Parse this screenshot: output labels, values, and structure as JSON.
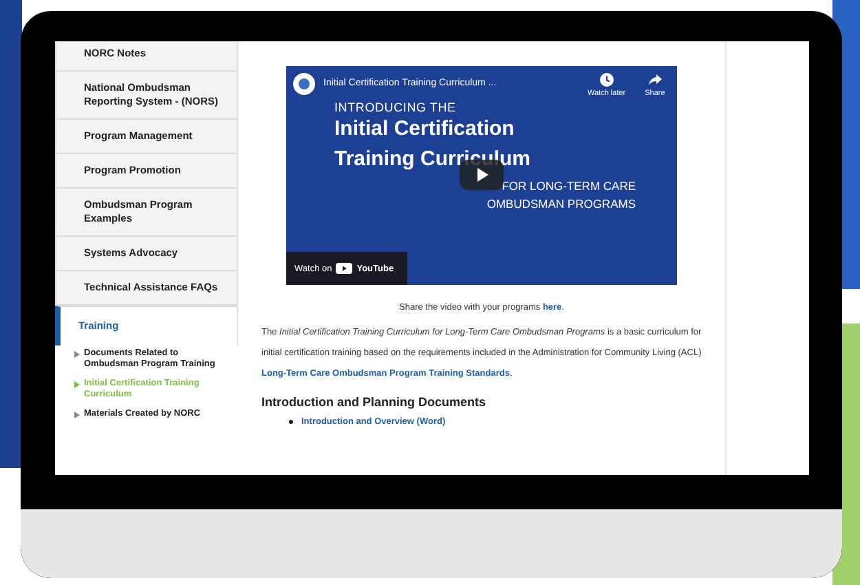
{
  "sidebar": {
    "items": [
      {
        "label": "NORC Notes",
        "selected": false
      },
      {
        "label": "National Ombudsman Reporting System - (NORS)",
        "selected": false
      },
      {
        "label": "Program Management",
        "selected": false
      },
      {
        "label": "Program Promotion",
        "selected": false
      },
      {
        "label": "Ombudsman Program Examples",
        "selected": false
      },
      {
        "label": "Systems Advocacy",
        "selected": false
      },
      {
        "label": "Technical Assistance FAQs",
        "selected": false
      },
      {
        "label": "Training",
        "selected": true,
        "children": [
          {
            "label": "Documents Related to Ombudsman Program Training",
            "selected": false
          },
          {
            "label": "Initial Certification Training Curriculum",
            "selected": true
          },
          {
            "label": "Materials Created by NORC",
            "selected": false
          }
        ]
      }
    ]
  },
  "video": {
    "title": "Initial Certification Training Curriculum ...",
    "watch_later": "Watch later",
    "share": "Share",
    "kicker": "INTRODUCING THE",
    "headline": [
      "Initial Certification",
      "Training Curriculum"
    ],
    "subline": [
      "FOR LONG-TERM CARE",
      "OMBUDSMAN PROGRAMS"
    ],
    "watch_on": "Watch on",
    "youtube": "YouTube"
  },
  "share_line": [
    {
      "kind": "text",
      "text": "Share the video with your programs "
    },
    {
      "kind": "link",
      "text": "here"
    },
    {
      "kind": "text",
      "text": "."
    }
  ],
  "intro": [
    {
      "kind": "text",
      "text": "The "
    },
    {
      "kind": "italic",
      "text": "Initial Certification Training Curriculum for Long-Term Care Ombudsman Programs"
    },
    {
      "kind": "text",
      "text": " is a basic curriculum for initial certification training based on the requirements included in the Administration for Community Living (ACL) "
    },
    {
      "kind": "link",
      "text": "Long-Term Care Ombudsman Program Training Standards"
    },
    {
      "kind": "text",
      "text": "."
    }
  ],
  "section": {
    "heading": "Introduction and Planning Documents",
    "links": [
      "Introduction and Overview (Word)"
    ]
  }
}
